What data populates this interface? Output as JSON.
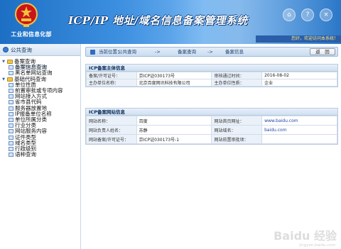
{
  "header": {
    "org": "工业和信息化部",
    "title": "ICP/IP 地址/域名信息备案管理系统",
    "welcome": "您好，欢迎访问本系统！"
  },
  "sidebar": {
    "title": "公共查询",
    "tree": [
      {
        "label": "备案查询",
        "level": 0,
        "kind": "folder"
      },
      {
        "label": "备案信息查询",
        "level": 1,
        "kind": "page",
        "selected": true
      },
      {
        "label": "黑名单网站查询",
        "level": 1,
        "kind": "page"
      },
      {
        "label": "基础代码查询",
        "level": 0,
        "kind": "folder"
      },
      {
        "label": "单位性质",
        "level": 1,
        "kind": "page"
      },
      {
        "label": "前置审批或专项内容",
        "level": 1,
        "kind": "page"
      },
      {
        "label": "网站接入方式",
        "level": 1,
        "kind": "page"
      },
      {
        "label": "省市县代码",
        "level": 1,
        "kind": "page"
      },
      {
        "label": "服务器放置地",
        "level": 1,
        "kind": "page"
      },
      {
        "label": "IP报备单位名称",
        "level": 1,
        "kind": "page"
      },
      {
        "label": "单位所属分类",
        "level": 1,
        "kind": "page"
      },
      {
        "label": "行业分类",
        "level": 1,
        "kind": "page"
      },
      {
        "label": "网站服务内容",
        "level": 1,
        "kind": "page"
      },
      {
        "label": "证件类型",
        "level": 1,
        "kind": "page"
      },
      {
        "label": "域名类型",
        "level": 1,
        "kind": "page"
      },
      {
        "label": "行政级别",
        "level": 1,
        "kind": "page"
      },
      {
        "label": "语种查询",
        "level": 1,
        "kind": "page"
      }
    ]
  },
  "breadcrumb": {
    "prefix": "当前位置：",
    "items": [
      "公共查询",
      "备案查询",
      "备案信息"
    ],
    "sep": "->"
  },
  "back_label": "返　回",
  "subject_panel": {
    "title": "ICP备案主体信息",
    "rows": [
      [
        "备案/许可证号：",
        "京ICP证030173号",
        "审核通过时间：",
        "2016-08-02"
      ],
      [
        "主办单位名称：",
        "北京百度网讯科技有限公司",
        "主办单位性质：",
        "企业"
      ]
    ]
  },
  "site_panel": {
    "title": "ICP备案网站信息",
    "rows": [
      [
        "网站名称：",
        "百度",
        "网站首页网址：",
        "www.baidu.com"
      ],
      [
        "网站负责人姓名：",
        "苏静",
        "网站域名：",
        "baidu.com"
      ],
      [
        "网站备案/许可证号：",
        "京ICP证030173号-1",
        "网站前置审批项：",
        ""
      ]
    ]
  },
  "watermark": {
    "text": "Baidu 经验",
    "sub": "jingyan.baidu.com"
  },
  "colors": {
    "header_blue": "#2a77c8",
    "panel_border": "#b8cbe2",
    "key_cell": "#eaf1f9"
  }
}
